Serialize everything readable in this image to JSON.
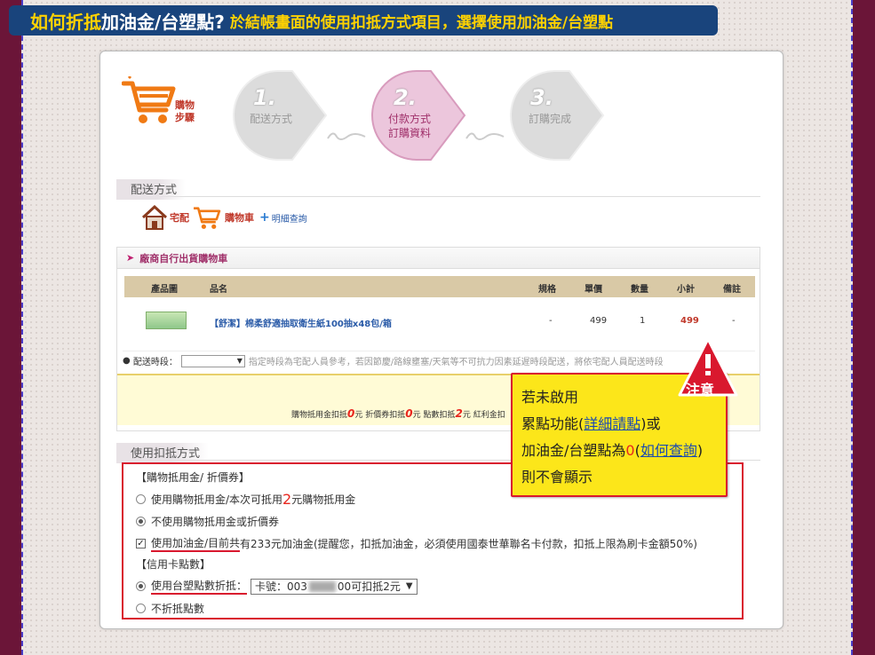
{
  "title": {
    "part1": "如何折抵",
    "part2": "加油金/台塑點?",
    "part3": "於結帳畫面的使用扣抵方式項目，選擇使用加油金/台塑點"
  },
  "steps": {
    "label_line1": "購物",
    "label_line2": "步驟",
    "items": [
      {
        "num": "1.",
        "line1": "配送方式",
        "line2": ""
      },
      {
        "num": "2.",
        "line1": "付款方式",
        "line2": "訂購資料"
      },
      {
        "num": "3.",
        "line1": "訂購完成",
        "line2": ""
      }
    ]
  },
  "delivery": {
    "section_title": "配送方式",
    "home_label": "宅配",
    "cart_label": "購物車",
    "detail_link": "明細查詢"
  },
  "cart": {
    "header": "廠商自行出貨購物車",
    "columns": [
      "產品圖",
      "品名",
      "規格",
      "單價",
      "數量",
      "小計",
      "備註"
    ],
    "row": {
      "name": "【舒潔】棉柔舒適抽取衛生紙100抽x48包/箱",
      "spec": "-",
      "price": "499",
      "qty": "1",
      "subtotal": "499",
      "note": "-"
    },
    "time_label": "配送時段：",
    "time_note": "指定時段為宅配人員參考，若因節慶/路線壅塞/天氣等不可抗力因素延遲時段配送，將依宅配人員配送時段",
    "summary": {
      "t1": "購物抵用金扣抵",
      "v1": "0",
      "t2": "元 折價券扣抵",
      "v2": "0",
      "t3": "元 點數扣抵",
      "v3": "2",
      "t4": "元 紅利金扣"
    }
  },
  "payment": {
    "section_title": "使用扣抵方式",
    "group1": "【購物抵用金/ 折價券】",
    "opt1_pre": "使用購物抵用金/本次可抵用",
    "opt1_num": "2",
    "opt1_post": "元購物抵用金",
    "opt2": "不使用購物抵用金或折價券",
    "opt3_main": "使用加油金/目前共",
    "opt3_rest": "有233元加油金(提醒您，扣抵加油金，必須使用國泰世華聯名卡付款，扣抵上限為刷卡金額50%)",
    "group2": "【信用卡點數】",
    "opt4": "使用台塑點數折抵：",
    "card_pre": "卡號：003",
    "card_post": "00可扣抵2元",
    "opt5": "不折抵點數"
  },
  "callout": {
    "warn": "注意",
    "line1": "若未啟用",
    "line2_pre": "累點功能(",
    "line2_link": "詳細請點",
    "line2_post": ")或",
    "line3_pre": "加油金/台塑點為",
    "line3_zero": "0",
    "line3_mid": "(",
    "line3_link": "如何查詢",
    "line3_post": ")",
    "line4": "則不會顯示"
  },
  "colors": {
    "accent": "#d9182e",
    "title_bg": "#19447c",
    "callout_bg": "#fce61a"
  }
}
